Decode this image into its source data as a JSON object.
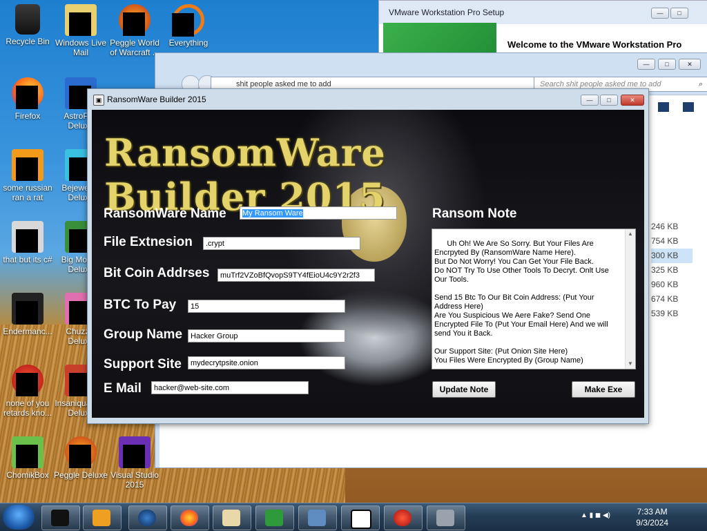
{
  "desktop": {
    "icons": [
      {
        "label": "Recycle Bin"
      },
      {
        "label": "Windows Live Mail"
      },
      {
        "label": "Peggle World of Warcraft ..."
      },
      {
        "label": "Everything"
      },
      {
        "label": "Firefox"
      },
      {
        "label": "AstroPop Deluxe"
      },
      {
        "label": "some russian ran a rat"
      },
      {
        "label": "Bejeweled Deluxe"
      },
      {
        "label": "that but its c#"
      },
      {
        "label": "Big Money Deluxe"
      },
      {
        "label": "Endermanc..."
      },
      {
        "label": "Chuzzle Deluxe"
      },
      {
        "label": "none of you retards kno..."
      },
      {
        "label": "Insaniquarium Deluxe"
      },
      {
        "label": "ChomikBox"
      },
      {
        "label": "Peggle Deluxe"
      },
      {
        "label": "Visual Studio 2015"
      }
    ]
  },
  "vmware": {
    "title": "VMware Workstation Pro Setup",
    "welcome": "Welcome to the VMware Workstation Pro"
  },
  "explorer": {
    "address": "shit people asked me to add",
    "search_placeholder": "Search shit people asked me to add",
    "sizes": [
      "246 KB",
      "754 KB",
      "300 KB",
      "325 KB",
      "960 KB",
      "674 KB",
      "539 KB"
    ]
  },
  "builder": {
    "window_title": "RansomWare Builder 2015",
    "banner": "RansomWare Builder 2015",
    "fields": {
      "name_label": "RansomWare Name",
      "name_value": "My Ransom Ware",
      "ext_label": "File Extnesion",
      "ext_value": ".crypt",
      "btc_addr_label": "Bit Coin Addrses",
      "btc_addr_value": "muTrf2VZoBfQvopS9TY4fEioU4c9Y2r2f3",
      "btc_pay_label": "BTC To Pay",
      "btc_pay_value": "15",
      "group_label": "Group Name",
      "group_value": "Hacker Group",
      "site_label": "Support Site",
      "site_value": "mydecrytpsite.onion",
      "email_label": "E Mail",
      "email_value": "hacker@web-site.com"
    },
    "note_label": "Ransom Note",
    "note_text": "Uh Oh! We Are So Sorry. But Your Files Are Encrpyted By (RansomWare Name Here).\nBut Do Not Worry! You Can Get Your File Back.\nDo NOT Try To Use Other Tools To Decryt. Onlt Use Our Tools.\n\nSend 15 Btc To Our Bit Coin Address: (Put Your Address Here)\nAre You Suspicious We Aere Fake? Send One Encrypted File To (Put Your Email Here) And we will send You it Back.\n\nOur Support Site: (Put Onion Site Here)\nYou Files Were Encrypted By (Group Name)",
    "update_button": "Update Note",
    "make_button": "Make Exe"
  },
  "taskbar": {
    "time": "7:33 AM",
    "date": "9/3/2024"
  }
}
